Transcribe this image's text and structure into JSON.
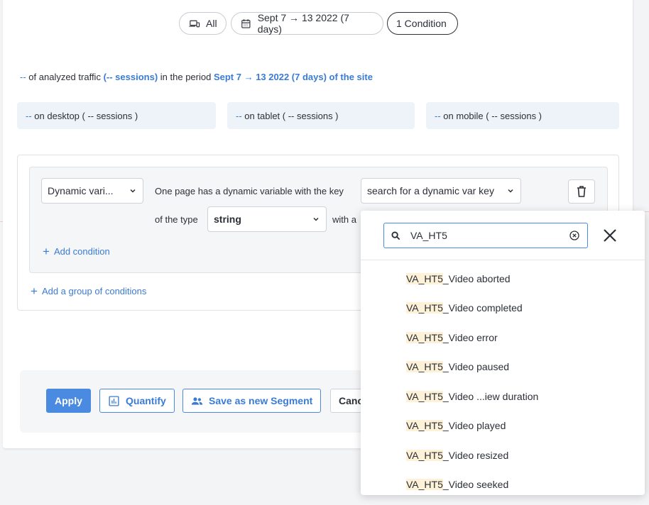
{
  "filters": {
    "device_label": "All",
    "period_label": "Sept 7 → 13 2022 (7 days)",
    "condition_label": "1 Condition"
  },
  "summary": {
    "traffic_value": "--",
    "traffic_text": "of analyzed traffic",
    "sessions_text": "(-- sessions)",
    "period_text": "in the period",
    "period_link": "Sept 7 → 13 2022 (7 days) of the site"
  },
  "devices": [
    {
      "value": "--",
      "label": "on desktop ( -- sessions )"
    },
    {
      "value": "--",
      "label": "on tablet ( -- sessions )"
    },
    {
      "value": "--",
      "label": "on mobile ( -- sessions )"
    }
  ],
  "condition": {
    "type_select": "Dynamic vari...",
    "key_text": "One page has a dynamic variable with the key",
    "key_placeholder": "search for a dynamic var key",
    "of_type_text": "of the type",
    "type_value": "string",
    "with_text": "with a",
    "add_condition": "Add condition",
    "add_group": "Add a group of conditions"
  },
  "actions": {
    "apply": "Apply",
    "quantify": "Quantify",
    "save_segment": "Save as new Segment",
    "cancel": "Canc"
  },
  "dropdown": {
    "search_value": "VA_HT5",
    "highlight": "VA_HT5",
    "items": [
      "_Video aborted",
      "_Video completed",
      "_Video error",
      "_Video paused",
      "_Video ...iew duration",
      "_Video played",
      "_Video resized",
      "_Video seeked"
    ]
  }
}
